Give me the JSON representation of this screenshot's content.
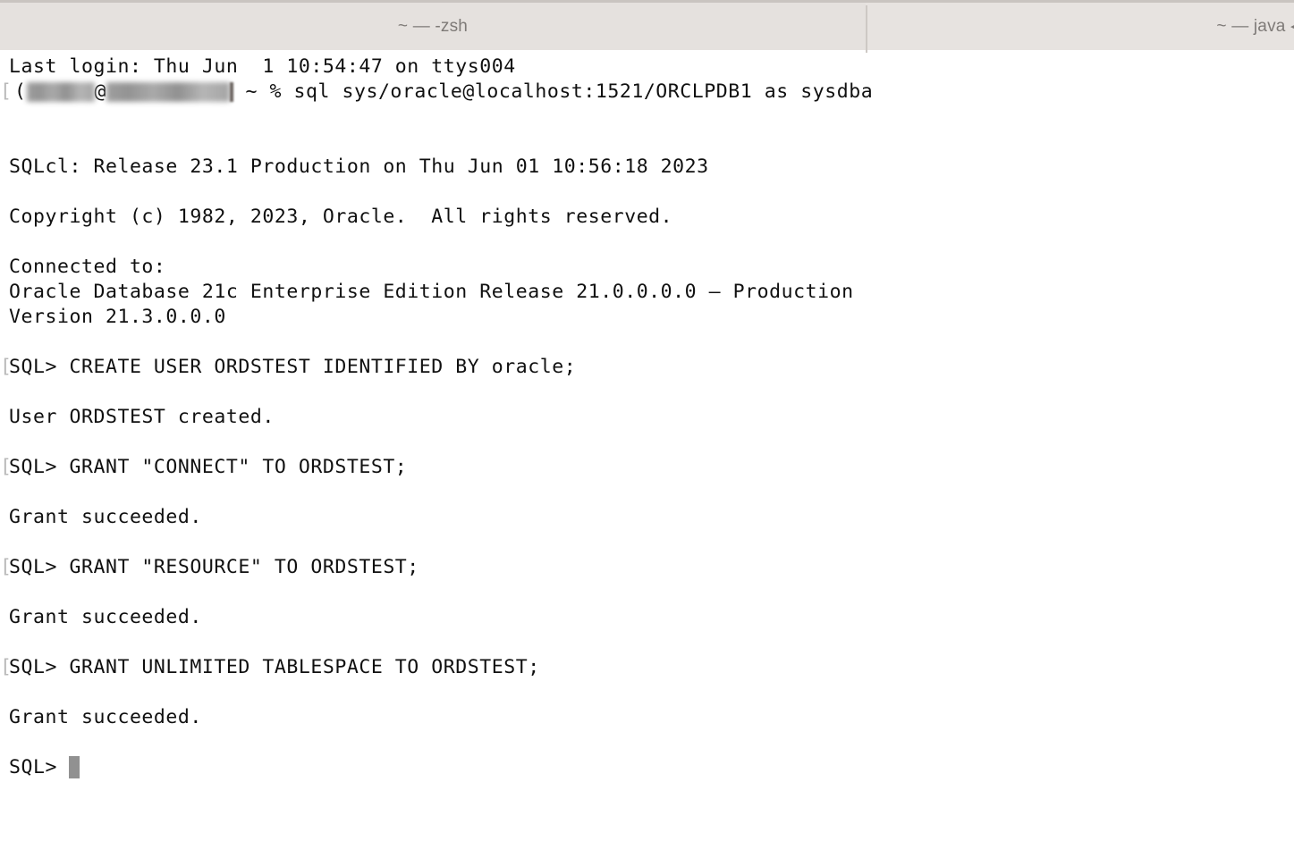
{
  "window": {
    "chrome_color": "#e5e1de",
    "terminal_bg": "#ffffff",
    "terminal_fg": "#101010",
    "cursor_color": "#919191"
  },
  "tabs": [
    {
      "label": "~ — -zsh",
      "active": true
    },
    {
      "label": "~ — java ◂ o",
      "active": false
    }
  ],
  "terminal": {
    "prompt_mark": "[",
    "cursor_glyph": "█",
    "lines": [
      {
        "kind": "text",
        "text": "Last login: Thu Jun  1 10:54:47 on ttys004"
      },
      {
        "kind": "prompt_redacted",
        "mark": "[",
        "bracket_open": "(",
        "at": "@",
        "suffix": " ~ % ",
        "command": "sql sys/oracle@localhost:1521/ORCLPDB1 as sysdba"
      },
      {
        "kind": "blank",
        "text": ""
      },
      {
        "kind": "blank",
        "text": ""
      },
      {
        "kind": "text",
        "text": "SQLcl: Release 23.1 Production on Thu Jun 01 10:56:18 2023"
      },
      {
        "kind": "blank",
        "text": ""
      },
      {
        "kind": "text",
        "text": "Copyright (c) 1982, 2023, Oracle.  All rights reserved."
      },
      {
        "kind": "blank",
        "text": ""
      },
      {
        "kind": "text",
        "text": "Connected to:"
      },
      {
        "kind": "text",
        "text": "Oracle Database 21c Enterprise Edition Release 21.0.0.0.0 – Production"
      },
      {
        "kind": "text",
        "text": "Version 21.3.0.0.0"
      },
      {
        "kind": "blank",
        "text": ""
      },
      {
        "kind": "sql",
        "mark": "[",
        "text": "SQL> CREATE USER ORDSTEST IDENTIFIED BY oracle;"
      },
      {
        "kind": "blank",
        "text": ""
      },
      {
        "kind": "text",
        "text": "User ORDSTEST created."
      },
      {
        "kind": "blank",
        "text": ""
      },
      {
        "kind": "sql",
        "mark": "[",
        "text": "SQL> GRANT \"CONNECT\" TO ORDSTEST;"
      },
      {
        "kind": "blank",
        "text": ""
      },
      {
        "kind": "text",
        "text": "Grant succeeded."
      },
      {
        "kind": "blank",
        "text": ""
      },
      {
        "kind": "sql",
        "mark": "[",
        "text": "SQL> GRANT \"RESOURCE\" TO ORDSTEST;"
      },
      {
        "kind": "blank",
        "text": ""
      },
      {
        "kind": "text",
        "text": "Grant succeeded."
      },
      {
        "kind": "blank",
        "text": ""
      },
      {
        "kind": "sql",
        "mark": "[",
        "text": "SQL> GRANT UNLIMITED TABLESPACE TO ORDSTEST;"
      },
      {
        "kind": "blank",
        "text": ""
      },
      {
        "kind": "text",
        "text": "Grant succeeded."
      },
      {
        "kind": "blank",
        "text": ""
      },
      {
        "kind": "cursor_prompt",
        "text": "SQL> "
      }
    ]
  }
}
